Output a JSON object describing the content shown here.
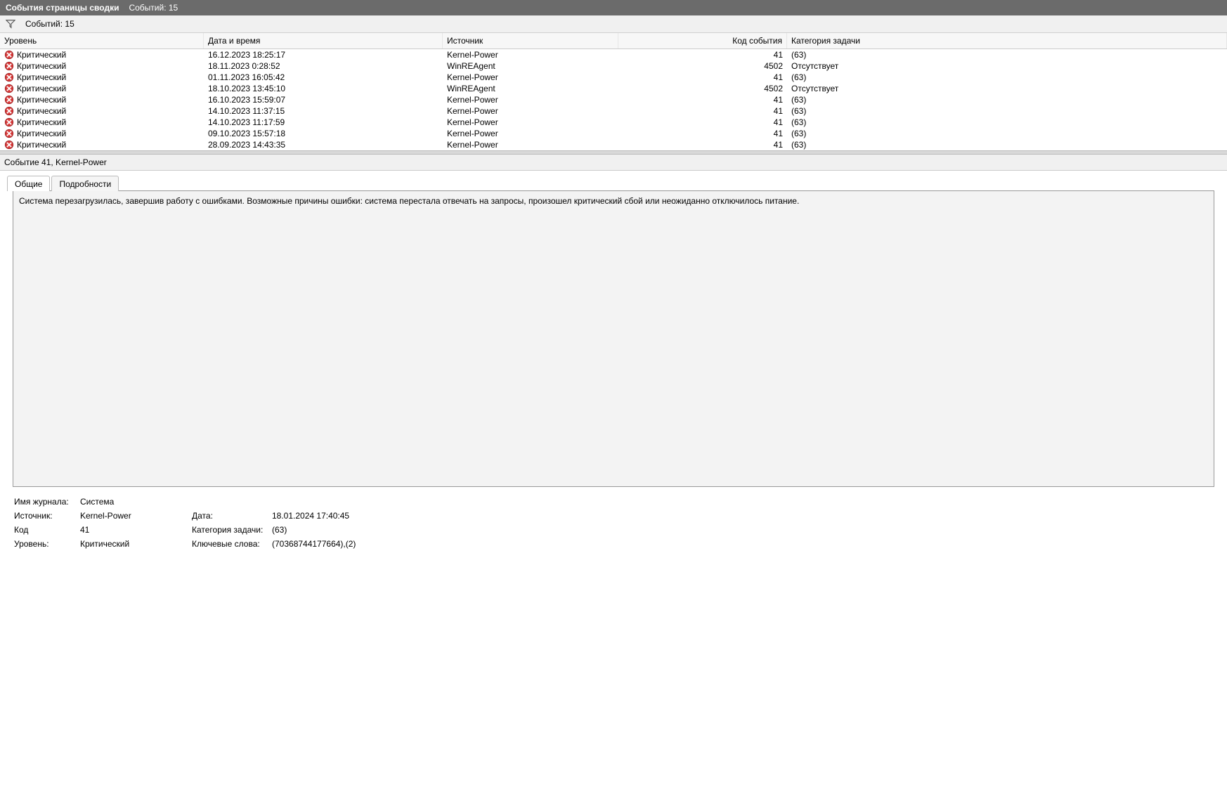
{
  "titlebar": {
    "title": "События страницы сводки",
    "count_label": "Событий: 15"
  },
  "filterbar": {
    "count_label": "Событий: 15"
  },
  "grid": {
    "headers": {
      "level": "Уровень",
      "datetime": "Дата и время",
      "source": "Источник",
      "event_id": "Код события",
      "category": "Категория задачи"
    },
    "rows": [
      {
        "level": "Критический",
        "datetime": "16.12.2023 18:25:17",
        "source": "Kernel-Power",
        "event_id": "41",
        "category": "(63)"
      },
      {
        "level": "Критический",
        "datetime": "18.11.2023 0:28:52",
        "source": "WinREAgent",
        "event_id": "4502",
        "category": "Отсутствует"
      },
      {
        "level": "Критический",
        "datetime": "01.11.2023 16:05:42",
        "source": "Kernel-Power",
        "event_id": "41",
        "category": "(63)"
      },
      {
        "level": "Критический",
        "datetime": "18.10.2023 13:45:10",
        "source": "WinREAgent",
        "event_id": "4502",
        "category": "Отсутствует"
      },
      {
        "level": "Критический",
        "datetime": "16.10.2023 15:59:07",
        "source": "Kernel-Power",
        "event_id": "41",
        "category": "(63)"
      },
      {
        "level": "Критический",
        "datetime": "14.10.2023 11:37:15",
        "source": "Kernel-Power",
        "event_id": "41",
        "category": "(63)"
      },
      {
        "level": "Критический",
        "datetime": "14.10.2023 11:17:59",
        "source": "Kernel-Power",
        "event_id": "41",
        "category": "(63)"
      },
      {
        "level": "Критический",
        "datetime": "09.10.2023 15:57:18",
        "source": "Kernel-Power",
        "event_id": "41",
        "category": "(63)"
      },
      {
        "level": "Критический",
        "datetime": "28.09.2023 14:43:35",
        "source": "Kernel-Power",
        "event_id": "41",
        "category": "(63)"
      }
    ]
  },
  "detail": {
    "title": "Событие 41, Kernel-Power",
    "tabs": {
      "general": "Общие",
      "details": "Подробности"
    },
    "description": "Система перезагрузилась, завершив работу с ошибками. Возможные причины ошибки: система перестала отвечать на запросы, произошел критический сбой или неожиданно отключилось питание.",
    "info": {
      "log_name_label": "Имя журнала:",
      "log_name": "Система",
      "source_label": "Источник:",
      "source": "Kernel-Power",
      "date_label": "Дата:",
      "date": "18.01.2024 17:40:45",
      "id_label": "Код",
      "id": "41",
      "category_label": "Категория задачи:",
      "category": "(63)",
      "level_label": "Уровень:",
      "level": "Критический",
      "keywords_label": "Ключевые слова:",
      "keywords": "(70368744177664),(2)"
    }
  }
}
